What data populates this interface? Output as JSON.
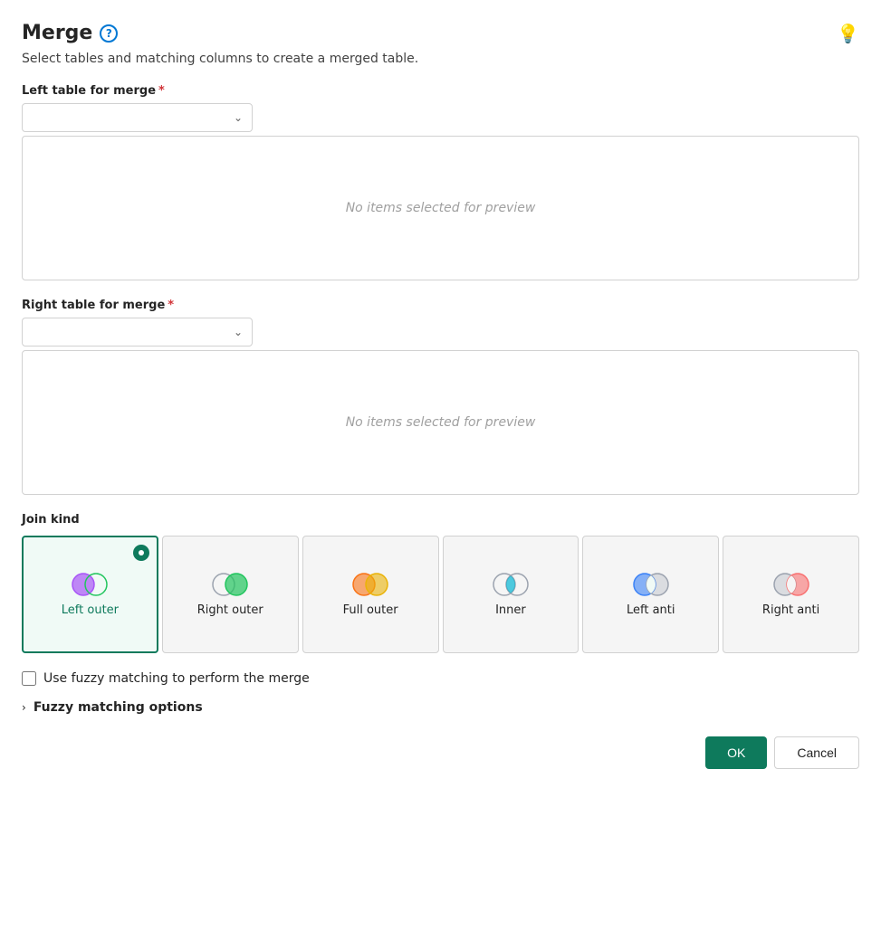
{
  "header": {
    "title": "Merge",
    "subtitle": "Select tables and matching columns to create a merged table.",
    "help_icon_label": "?",
    "bulb_icon": "💡"
  },
  "left_table": {
    "label": "Left table for merge",
    "required": true,
    "placeholder": "",
    "preview_empty_text": "No items selected for preview"
  },
  "right_table": {
    "label": "Right table for merge",
    "required": true,
    "placeholder": "",
    "preview_empty_text": "No items selected for preview"
  },
  "join_kind": {
    "section_label": "Join kind",
    "options": [
      {
        "id": "left-outer",
        "label": "Left outer",
        "selected": true
      },
      {
        "id": "right-outer",
        "label": "Right outer",
        "selected": false
      },
      {
        "id": "full-outer",
        "label": "Full outer",
        "selected": false
      },
      {
        "id": "inner",
        "label": "Inner",
        "selected": false
      },
      {
        "id": "left-anti",
        "label": "Left anti",
        "selected": false
      },
      {
        "id": "right-anti",
        "label": "Right anti",
        "selected": false
      }
    ]
  },
  "fuzzy": {
    "checkbox_label": "Use fuzzy matching to perform the merge",
    "options_label": "Fuzzy matching options"
  },
  "footer": {
    "ok_label": "OK",
    "cancel_label": "Cancel"
  }
}
